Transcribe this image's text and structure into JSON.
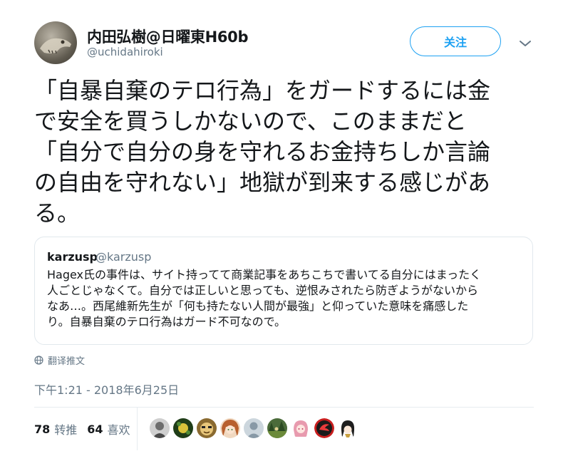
{
  "author": {
    "display_name": "内田弘樹@日曜東H60b",
    "handle": "@uchidahiroki",
    "avatar_icon": "dinosaur-skeleton-avatar"
  },
  "follow_button": {
    "label": "关注"
  },
  "menu_icon": "chevron-down-icon",
  "tweet": {
    "lines": [
      "「自暴自棄のテロ行為」をガードするには金",
      "で安全を買うしかないので、このままだと",
      "「自分で自分の身を守れるお金持ちしか言論",
      "の自由を守れない」地獄が到来する感じがあ",
      "る。"
    ]
  },
  "quoted_tweet": {
    "name": "karzusp",
    "handle": "@karzusp",
    "lines": [
      "Hagex氏の事件は、サイト持ってて商業記事をあちこちで書いてる自分にはまったく",
      "人ごとじゃなくて。自分では正しいと思っても、逆恨みされたら防ぎようがないから",
      "なあ…。西尾維新先生が「何も持たない人間が最強」と仰っていた意味を痛感した",
      "り。自暴自棄のテロ行為はガード不可なので。"
    ]
  },
  "translate": {
    "label": "翻译推文",
    "icon": "globe-icon"
  },
  "timestamp": "下午1:21 - 2018年6月25日",
  "stats": {
    "retweets_count": "78",
    "retweets_label": "转推",
    "likes_count": "64",
    "likes_label": "喜欢"
  },
  "likers": [
    {
      "icon": "gray-portrait-avatar",
      "color": "#8a8a8a"
    },
    {
      "icon": "green-leaf-avatar",
      "color": "#2f5e22"
    },
    {
      "icon": "cartoon-face-avatar",
      "color": "#b58a3c"
    },
    {
      "icon": "anime-girl-avatar",
      "color": "#c47a4a"
    },
    {
      "icon": "default-egg-avatar",
      "color": "#a8b4bd"
    },
    {
      "icon": "forest-scene-avatar",
      "color": "#3e5c2e"
    },
    {
      "icon": "pink-anime-avatar",
      "color": "#e8a0b0"
    },
    {
      "icon": "red-bird-avatar",
      "color": "#c81e1e"
    },
    {
      "icon": "dark-hair-anime-avatar",
      "color": "#2a2a2a"
    }
  ],
  "colors": {
    "accent": "#1da1f2",
    "secondary_text": "#657786",
    "primary_text": "#14171a",
    "border": "#e1e8ed"
  }
}
